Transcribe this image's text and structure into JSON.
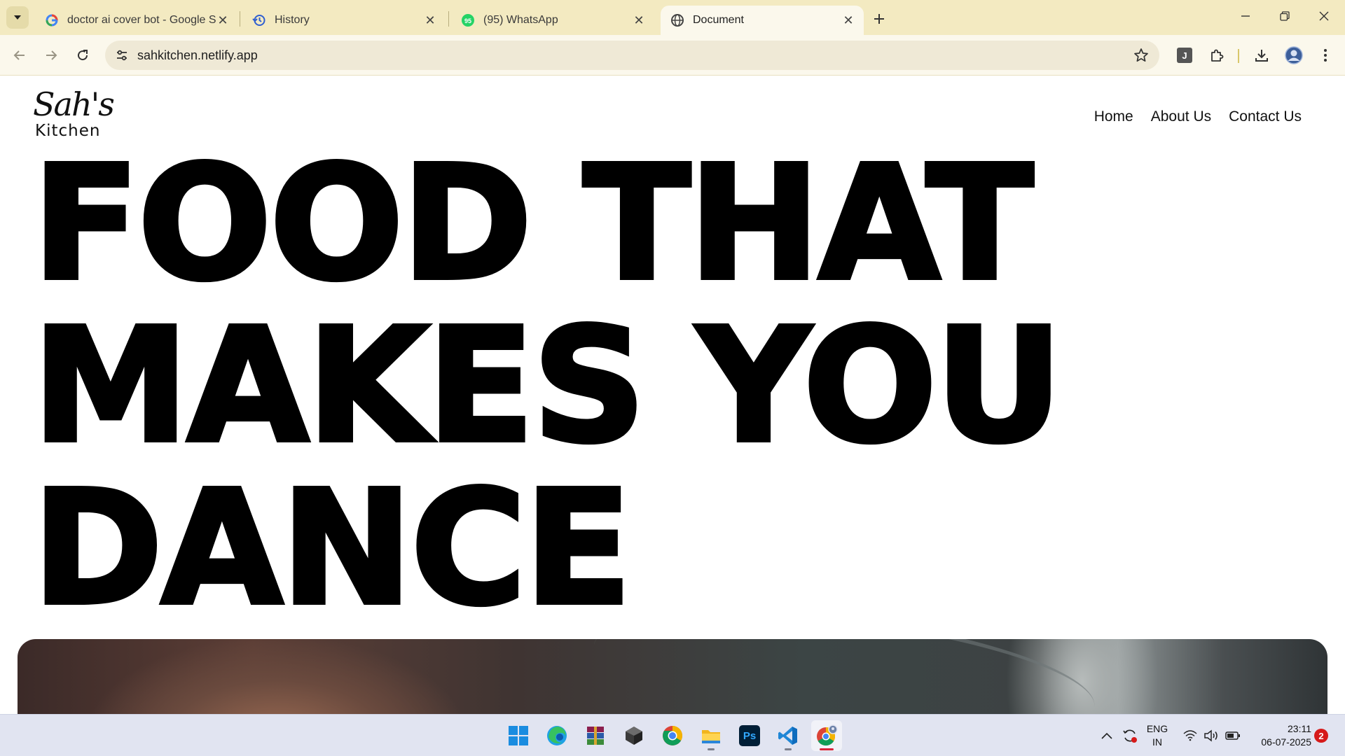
{
  "browser": {
    "tabs": [
      {
        "title": "doctor ai cover bot - Google Se",
        "favicon": "google-icon"
      },
      {
        "title": "History",
        "favicon": "history-icon"
      },
      {
        "title": "(95) WhatsApp",
        "favicon": "whatsapp-icon",
        "badge": "95"
      },
      {
        "title": "Document",
        "favicon": "globe-icon",
        "active": true
      }
    ],
    "address": "sahkitchen.netlify.app",
    "profile_initial": "J",
    "accent_color": "#f3eac1"
  },
  "site": {
    "logo_script": "Sah's",
    "logo_sub": "Kitchen",
    "nav": [
      "Home",
      "About Us",
      "Contact Us"
    ],
    "hero_lines": [
      "FOOD THAT",
      "MAKES YOU",
      "DANCE"
    ]
  },
  "taskbar": {
    "apps": [
      "windows-start-icon",
      "edge-icon",
      "winrar-icon",
      "obsidian-icon",
      "chrome-icon",
      "file-explorer-icon",
      "photoshop-icon",
      "vscode-icon",
      "chrome-canary-icon"
    ],
    "photoshop_label": "Ps",
    "language": "ENG",
    "region": "IN",
    "time": "23:11",
    "date": "06-07-2025",
    "notification_count": "2"
  }
}
